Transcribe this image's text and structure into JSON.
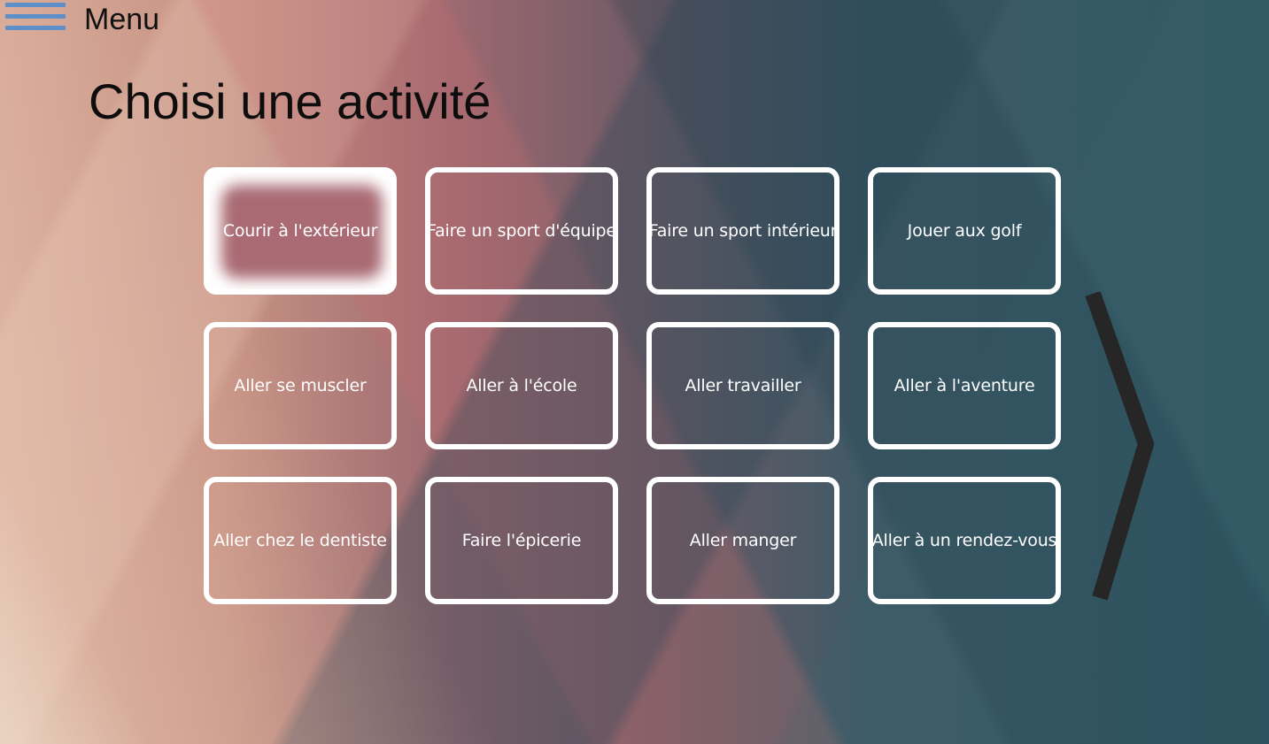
{
  "menu": {
    "label": "Menu",
    "icon": "hamburger-menu-icon",
    "icon_color": "#5e8fc8"
  },
  "page": {
    "title": "Choisi une activité"
  },
  "activities": [
    {
      "label": "Courir à l'extérieur",
      "selected": true
    },
    {
      "label": "Faire un sport d'équipe",
      "selected": false
    },
    {
      "label": "Faire un sport intérieur",
      "selected": false
    },
    {
      "label": "Jouer aux golf",
      "selected": false
    },
    {
      "label": "Aller se muscler",
      "selected": false
    },
    {
      "label": "Aller à l'école",
      "selected": false
    },
    {
      "label": "Aller travailler",
      "selected": false
    },
    {
      "label": "Aller à l'aventure",
      "selected": false
    },
    {
      "label": "Aller chez le dentiste",
      "selected": false
    },
    {
      "label": "Faire l'épicerie",
      "selected": false
    },
    {
      "label": "Aller manger",
      "selected": false
    },
    {
      "label": "Aller à un rendez-vous",
      "selected": false
    }
  ],
  "navigation": {
    "next_icon": "chevron-right-icon",
    "arrow_color": "#262626"
  }
}
